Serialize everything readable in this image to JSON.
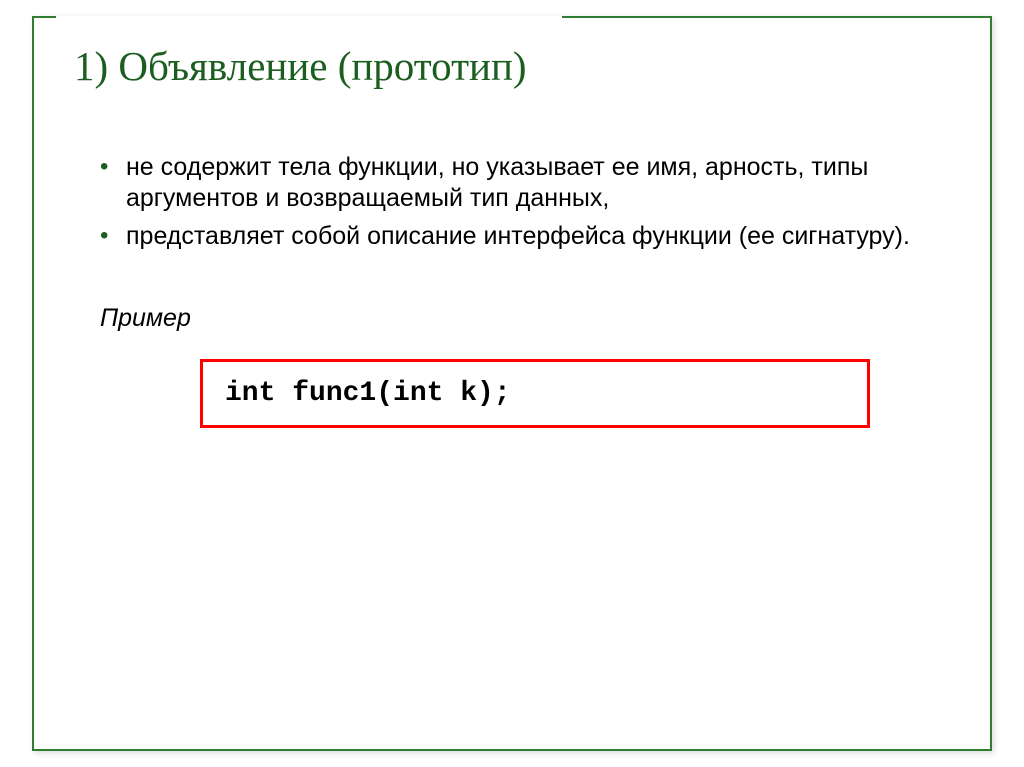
{
  "heading": "1) Объявление (прототип)",
  "bullets": [
    "не содержит тела функции, но указывает ее имя, арность, типы аргументов и возвращаемый тип данных,",
    "представляет собой описание интерфейса функции (ее сигнатуру)."
  ],
  "example_label": "Пример",
  "code": "int func1(int k);"
}
